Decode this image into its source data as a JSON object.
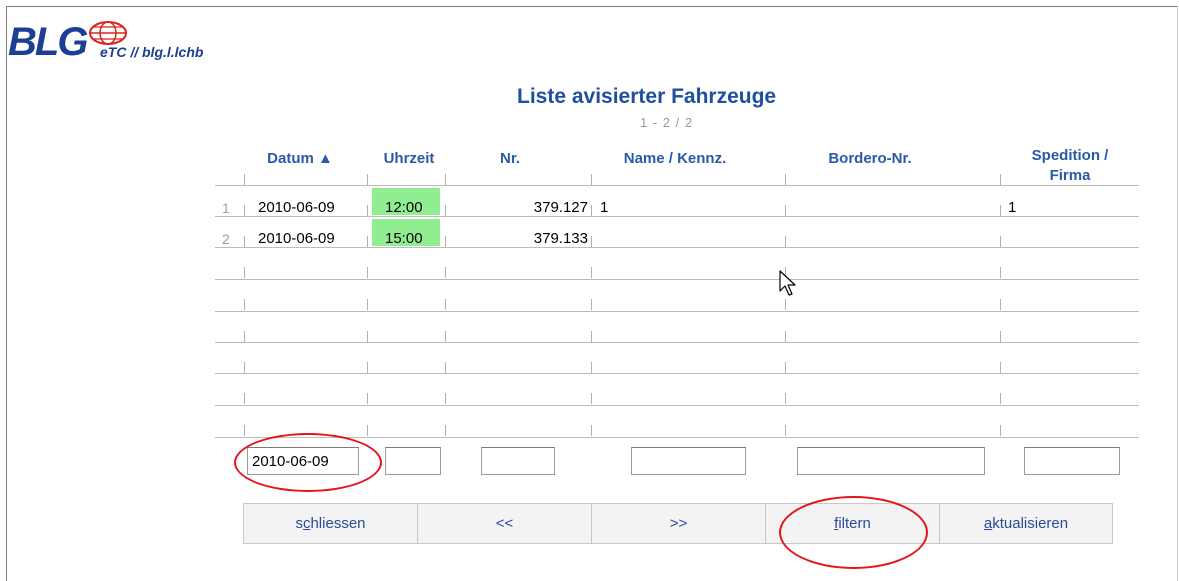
{
  "app": {
    "logo_text": "BLG",
    "subtitle": "eTC // blg.l.lchb",
    "accent_color": "#1f4f9f"
  },
  "page": {
    "title": "Liste avisierter Fahrzeuge",
    "count": "1 - 2 / 2"
  },
  "table": {
    "columns": [
      "Datum ▲",
      "Uhrzeit",
      "Nr.",
      "Name / Kennz.",
      "Bordero-Nr.",
      "Spedition / Firma"
    ],
    "columns_line1": [
      "Datum ▲",
      "Uhrzeit",
      "Nr.",
      "Name / Kennz.",
      "Bordero-Nr.",
      "Spedition /"
    ],
    "columns_line2": [
      "",
      "",
      "",
      "",
      "",
      "Firma"
    ],
    "rows": [
      {
        "num": "1",
        "datum": "2010-06-09",
        "uhrzeit": "12:00",
        "nr": "379.127",
        "name": "1",
        "bordero": "",
        "spedition": "1"
      },
      {
        "num": "2",
        "datum": "2010-06-09",
        "uhrzeit": "15:00",
        "nr": "379.133",
        "name": "",
        "bordero": "",
        "spedition": ""
      }
    ],
    "time_highlight_color": "#90ee90"
  },
  "filters": {
    "datum": "2010-06-09",
    "uhrzeit": "",
    "nr": "",
    "name": "",
    "bordero": "",
    "spedition": ""
  },
  "buttons": {
    "schliessen_pre": "s",
    "schliessen_key": "c",
    "schliessen_post": "hliessen",
    "prev": "<<",
    "next": ">>",
    "filtern_key": "f",
    "filtern_post": "iltern",
    "aktualisieren_key": "a",
    "aktualisieren_post": "ktualisieren"
  },
  "annotation_color": "#e3151a"
}
